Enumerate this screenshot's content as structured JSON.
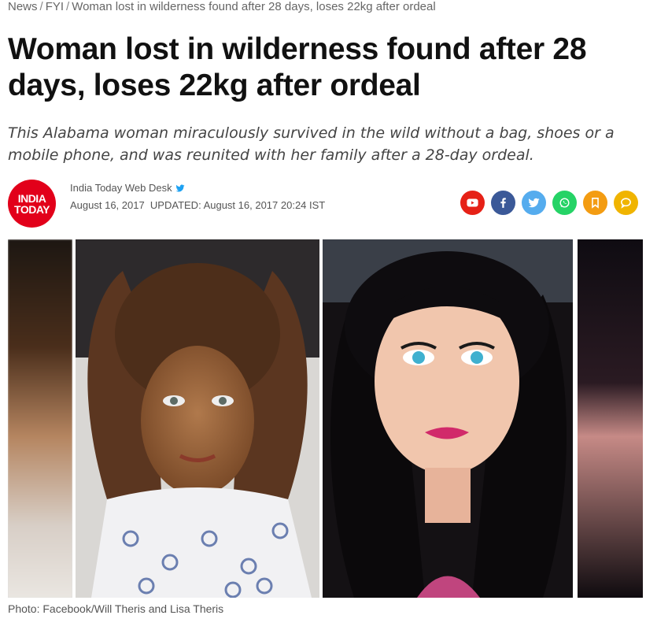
{
  "breadcrumb": {
    "items": [
      "News",
      "FYI",
      "Woman lost in wilderness found after 28 days, loses 22kg after ordeal"
    ],
    "separator": "/"
  },
  "article": {
    "headline": "Woman lost in wilderness found after 28 days, loses 22kg after ordeal",
    "summary": "This Alabama woman miraculously survived in the wild without a bag, shoes or a mobile phone, and was reunited with her family after a 28-day ordeal.",
    "logo": {
      "line1": "INDIA",
      "line2": "TODAY"
    },
    "author": "India Today Web Desk",
    "author_icon": "twitter-bird-icon",
    "dates": "August 16, 2017  UPDATED: August 16, 2017 20:24 IST",
    "photo_caption": "Photo: Facebook/Will Theris and Lisa Theris"
  },
  "share": [
    {
      "icon": "youtube-icon",
      "color": "#e62117"
    },
    {
      "icon": "facebook-icon",
      "color": "#3b5998"
    },
    {
      "icon": "twitter-icon",
      "color": "#55acee"
    },
    {
      "icon": "whatsapp-icon",
      "color": "#25d366"
    },
    {
      "icon": "bookmark-icon",
      "color": "#f39c12"
    },
    {
      "icon": "comment-icon",
      "color": "#f0b400"
    }
  ],
  "colors": {
    "brand": "#e2001a",
    "headline": "#111111",
    "text": "#444444"
  }
}
